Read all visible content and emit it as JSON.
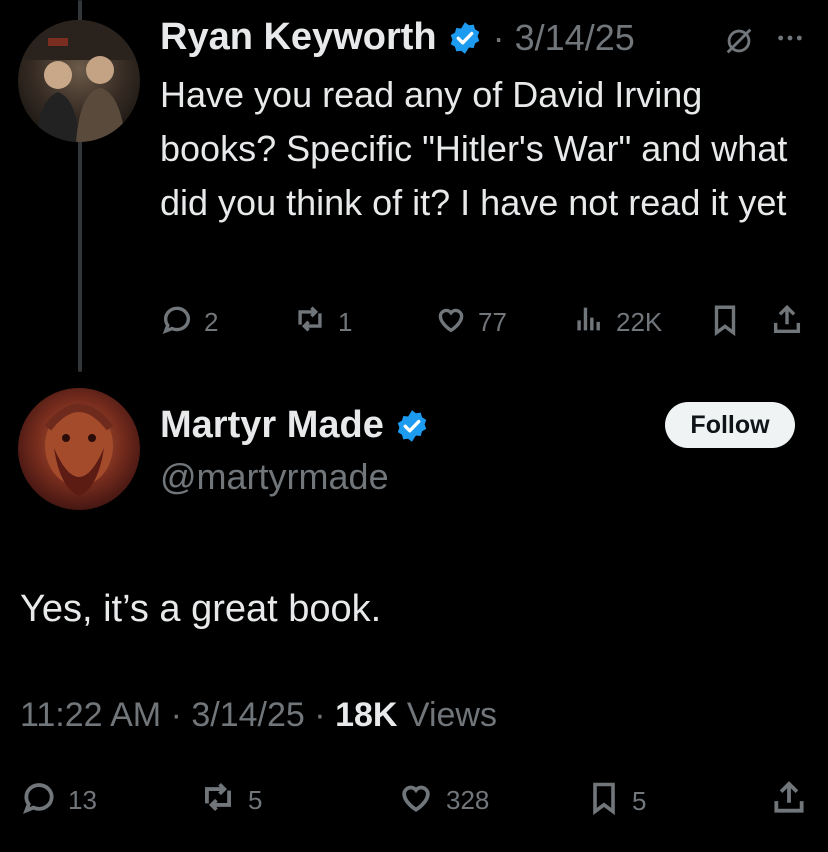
{
  "reply_context": {
    "author_name": "Ryan Keyworth",
    "date": "3/14/25",
    "text": "Have you read any of David Irving books? Specific \"Hitler's War\" and what did you think of it? I have not read it yet",
    "actions": {
      "replies": "2",
      "reposts": "1",
      "likes": "77",
      "views": "22K"
    },
    "icons": [
      "reply-icon",
      "repost-icon",
      "like-icon",
      "views-icon",
      "bookmark-icon",
      "share-icon",
      "verified-badge-icon",
      "muted-icon",
      "more-icon"
    ]
  },
  "main_tweet": {
    "author_name": "Martyr Made",
    "handle": "@martyrmade",
    "follow_label": "Follow",
    "text": "Yes, it’s a great book.",
    "time": "11:22 AM",
    "date": "3/14/25",
    "views_count": "18K",
    "views_label": "Views",
    "actions": {
      "replies": "13",
      "reposts": "5",
      "likes": "328",
      "bookmarks": "5"
    }
  },
  "colors": {
    "background": "#000000",
    "text": "#e7e9ea",
    "muted": "#71767b",
    "verified": "#1d9bf0",
    "follow_bg": "#eff3f4"
  }
}
